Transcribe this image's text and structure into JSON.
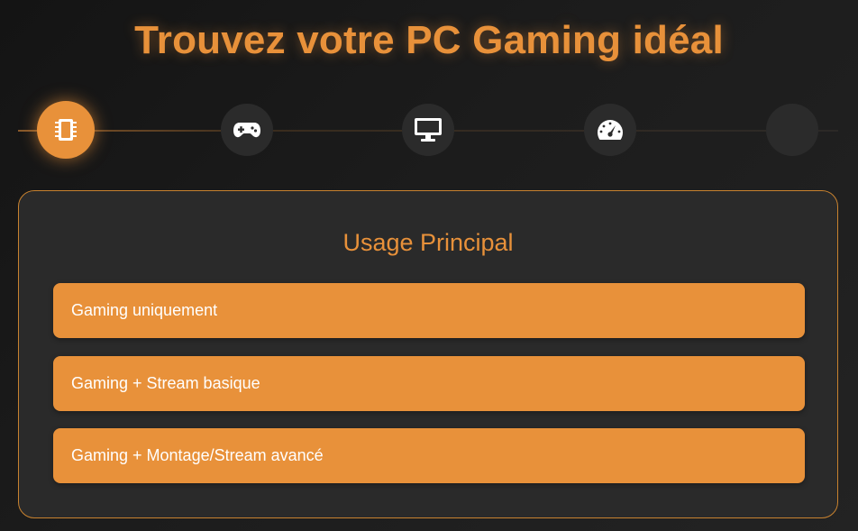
{
  "page": {
    "title": "Trouvez votre PC Gaming idéal"
  },
  "steps": [
    {
      "icon": "cpu-chip-icon",
      "active": true
    },
    {
      "icon": "gamepad-icon",
      "active": false
    },
    {
      "icon": "monitor-icon",
      "active": false
    },
    {
      "icon": "speedometer-icon",
      "active": false
    },
    {
      "icon": "empty-step",
      "active": false
    }
  ],
  "question": {
    "title": "Usage Principal",
    "options": [
      {
        "label": "Gaming uniquement"
      },
      {
        "label": "Gaming + Stream basique"
      },
      {
        "label": "Gaming + Montage/Stream avancé"
      }
    ]
  },
  "colors": {
    "accent": "#e8913a",
    "background": "#1c1c1c",
    "card": "#2a2a2a",
    "step_inactive": "#2b2b2b",
    "option_text": "#ffffff"
  }
}
